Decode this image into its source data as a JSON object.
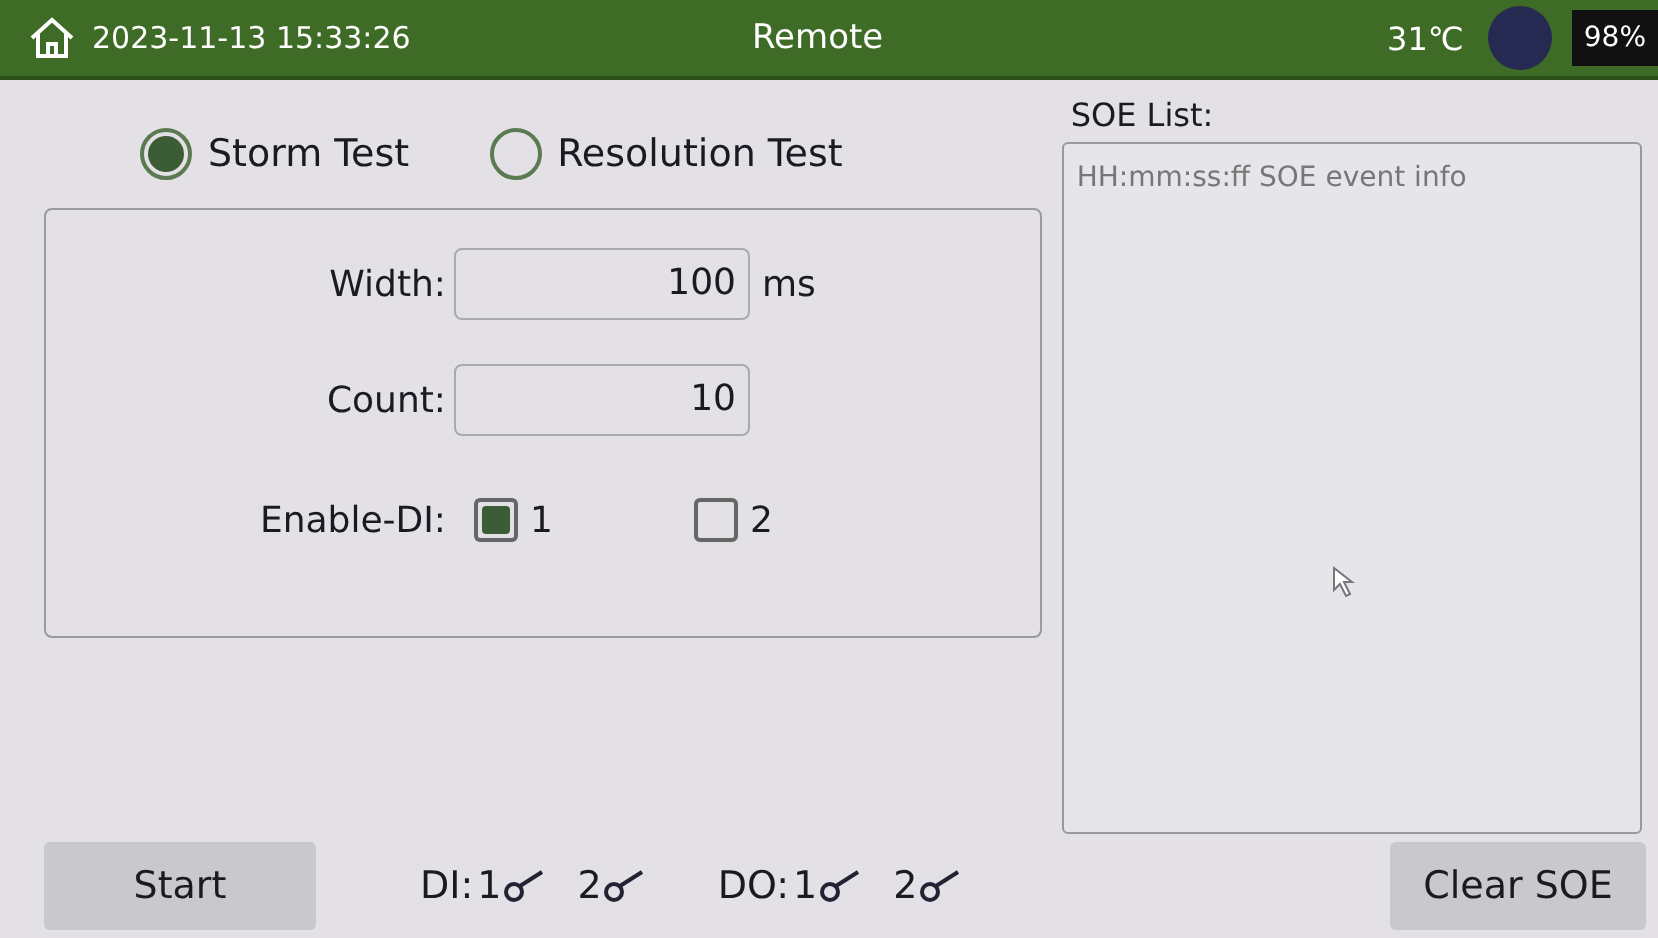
{
  "header": {
    "datetime": "2023-11-13 15:33:26",
    "title": "Remote",
    "temperature": "31℃",
    "battery": "98%"
  },
  "modes": [
    {
      "label": "Storm Test",
      "selected": true
    },
    {
      "label": "Resolution Test",
      "selected": false
    }
  ],
  "fields": [
    {
      "label": "Width:",
      "value": "100",
      "unit": "ms"
    },
    {
      "label": "Count:",
      "value": "10"
    }
  ],
  "enable_di": {
    "label": "Enable-DI:",
    "options": [
      {
        "label": "1",
        "checked": true
      },
      {
        "label": "2",
        "checked": false
      }
    ]
  },
  "soe": {
    "title": "SOE List:",
    "header_line": "HH:mm:ss:ff SOE event info"
  },
  "footer": {
    "start": "Start",
    "groups": [
      {
        "label": "DI:",
        "items": [
          "1",
          "2"
        ]
      },
      {
        "label": "DO:",
        "items": [
          "1",
          "2"
        ]
      }
    ],
    "clear": "Clear SOE"
  }
}
